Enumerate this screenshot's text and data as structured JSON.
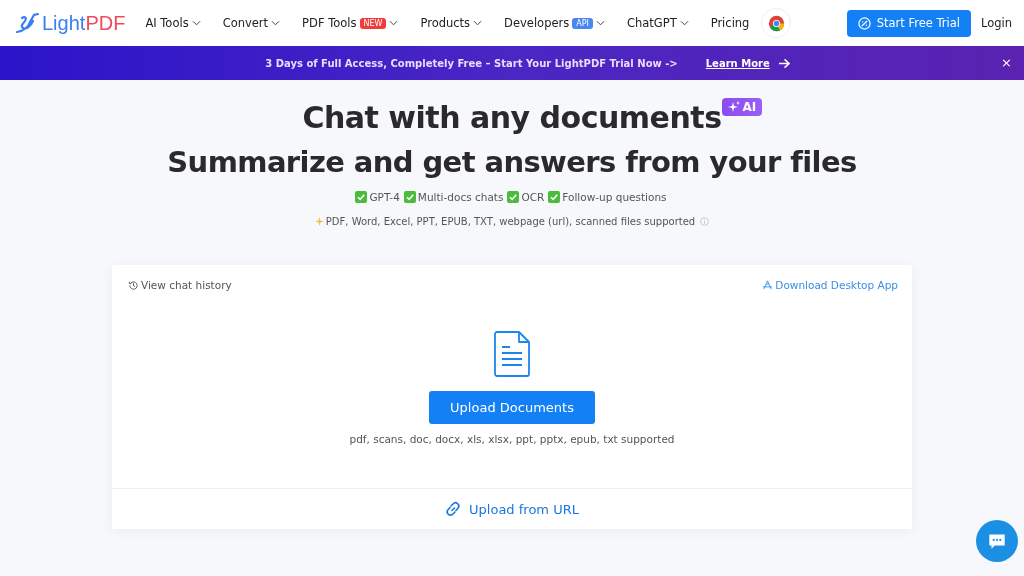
{
  "header": {
    "logo": [
      "Light",
      "PDF"
    ],
    "nav": [
      {
        "label": "AI Tools",
        "dropdown": true
      },
      {
        "label": "Convert",
        "dropdown": true
      },
      {
        "label": "PDF Tools",
        "badge": {
          "text": "NEW",
          "color": "#ef3d3d"
        },
        "dropdown": true
      },
      {
        "label": "Products",
        "dropdown": true
      },
      {
        "label": "Developers",
        "badge": {
          "text": "API",
          "color": "#4a86f2"
        },
        "dropdown": true
      },
      {
        "label": "ChatGPT",
        "dropdown": true
      },
      {
        "label": "Pricing",
        "dropdown": false
      }
    ],
    "trial_button": "Start Free Trial",
    "login": "Login"
  },
  "banner": {
    "text": "3 Days of Full Access, Completely Free – Start Your LightPDF Trial Now ->",
    "link": "Learn More",
    "close": "×"
  },
  "hero": {
    "title": "Chat with any documents",
    "ai_badge": "AI",
    "subtitle": "Summarize and get answers from your files",
    "features": [
      "GPT-4",
      "Multi-docs chats",
      "OCR",
      "Follow-up questions"
    ],
    "formats": "PDF, Word, Excel, PPT, EPUB, TXT, webpage (url), scanned files supported"
  },
  "upload_card": {
    "history_link": "View chat history",
    "desktop_link": "Download Desktop App",
    "upload_button": "Upload Documents",
    "supported": "pdf, scans, doc, docx, xls, xlsx, ppt, pptx, epub, txt supported",
    "url_link": "Upload from URL"
  }
}
